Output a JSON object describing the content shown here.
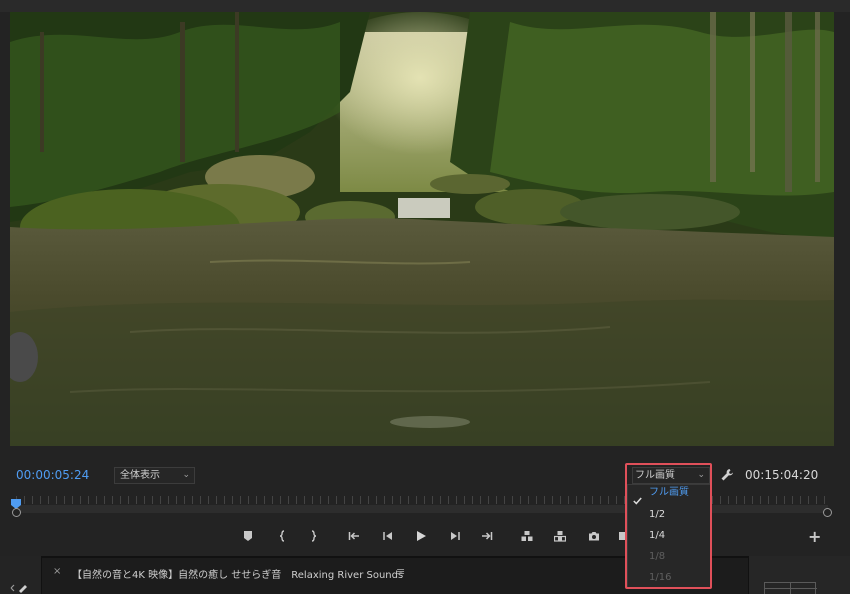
{
  "viewer": {
    "current_timecode": "00:00:05:24",
    "duration_timecode": "00:15:04:20",
    "zoom_select_value": "全体表示",
    "quality_select_value": "フル画質"
  },
  "quality_menu": {
    "items": [
      {
        "label": "フル画質",
        "checked": true,
        "enabled": true
      },
      {
        "label": "1/2",
        "checked": false,
        "enabled": true
      },
      {
        "label": "1/4",
        "checked": false,
        "enabled": true
      },
      {
        "label": "1/8",
        "checked": false,
        "enabled": false
      },
      {
        "label": "1/16",
        "checked": false,
        "enabled": false
      }
    ]
  },
  "timeline_tab": {
    "close_label": "×",
    "title": "【自然の音と4K 映像】自然の癒し せせらぎ音　Relaxing River Sounds",
    "menu_label": "≡"
  },
  "controls": {
    "add_label": "+"
  },
  "icons": {
    "transport": [
      "marker-icon",
      "mark-in-icon",
      "mark-out-icon",
      "go-to-in-icon",
      "step-back-icon",
      "play-icon",
      "step-forward-icon",
      "go-to-out-icon",
      "insert-icon",
      "overwrite-icon",
      "export-frame-icon"
    ],
    "settings": "wrench-icon",
    "check": "checkmark-icon"
  },
  "colors": {
    "accent": "#4f9cf2",
    "highlight": "#e0505a",
    "disabled_text": "#5f5f5f"
  }
}
